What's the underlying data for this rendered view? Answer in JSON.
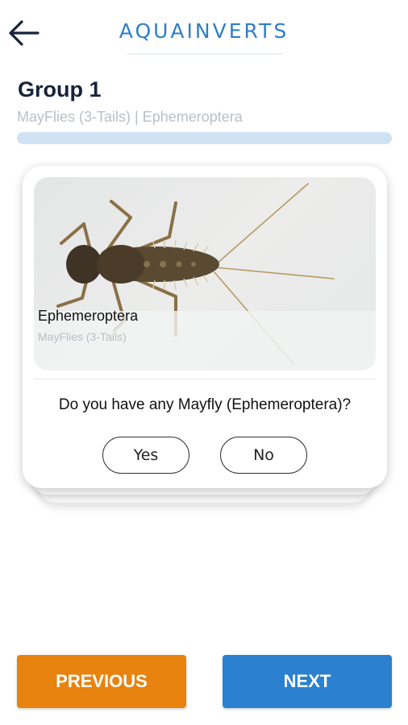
{
  "header": {
    "app_title": "AQUAINVERTS",
    "back_icon": "arrow-left-icon"
  },
  "group": {
    "title": "Group 1",
    "subtitle": "MayFlies (3-Tails) | Ephemeroptera",
    "progress": 0.0
  },
  "card": {
    "image": "mayfly-nymph-photo",
    "name": "Ephemeroptera",
    "common_name": "MayFlies (3-Tails)",
    "question": "Do you have any Mayfly (Ephemeroptera)?",
    "yes_label": "Yes",
    "no_label": "No"
  },
  "nav": {
    "previous_label": "PREVIOUS",
    "next_label": "NEXT"
  },
  "colors": {
    "brand_blue": "#2f7ec8",
    "previous_orange": "#e8830f",
    "next_blue": "#2b80cf",
    "progress_track": "#cfe2f3"
  }
}
